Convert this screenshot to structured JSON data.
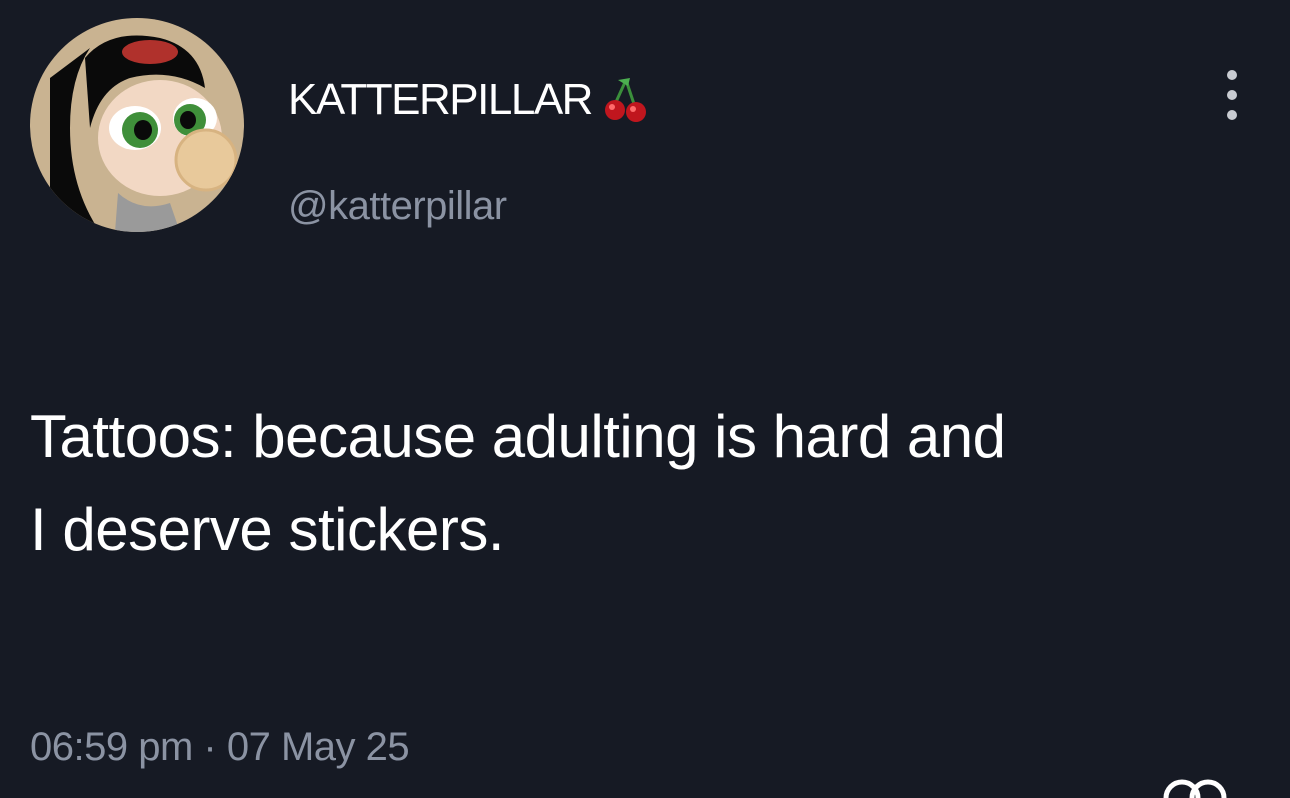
{
  "author": {
    "display_name": "KATTERPILLAR",
    "name_emoji": "cherry-icon",
    "handle": "@katterpillar"
  },
  "tweet": {
    "line1": "Tattoos: because adulting is hard and",
    "line2": "I deserve stickers.",
    "time": "06:59 pm",
    "separator": "·",
    "date": "07 May 25"
  },
  "icons": {
    "more": "more-vertical-icon",
    "corner": "logo-icon"
  },
  "colors": {
    "background": "#161a24",
    "primary_text": "#ffffff",
    "secondary_text": "#8b93a3"
  }
}
